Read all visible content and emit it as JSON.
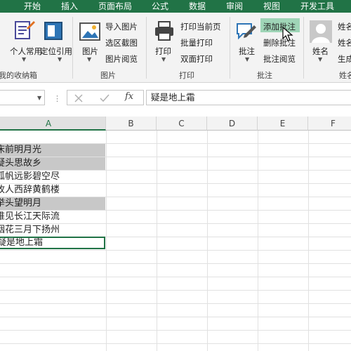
{
  "tabs": [
    "开始",
    "插入",
    "页面布局",
    "公式",
    "数据",
    "审阅",
    "视图",
    "开发工具"
  ],
  "ribbon": {
    "group_collection": {
      "label": "我的收纳箱",
      "buttons": [
        "个人常用",
        "定位引用"
      ]
    },
    "group_picture": {
      "label": "图片",
      "big_button": "图片",
      "small_buttons": [
        "导入图片",
        "选区截图",
        "图片阅览"
      ]
    },
    "group_print": {
      "label": "打印",
      "big_button": "打印",
      "small_buttons": [
        "打印当前页",
        "批量打印",
        "双面打印"
      ]
    },
    "group_comment": {
      "label": "批注",
      "big_button": "批注",
      "small_buttons": [
        "添加批注",
        "删除批注",
        "批注阅览"
      ]
    },
    "group_name": {
      "label": "姓名",
      "big_button": "姓名",
      "small_buttons": [
        "姓名",
        "姓名",
        "生成"
      ]
    }
  },
  "formula_bar": {
    "fx_label": "fx",
    "content": "疑是地上霜"
  },
  "columns": [
    "A",
    "B",
    "C",
    "D",
    "E",
    "F"
  ],
  "cells": [
    {
      "text": "床前明月光",
      "highlight": true
    },
    {
      "text": "疑头思故乡",
      "highlight": true
    },
    {
      "text": "孤帆远影碧空尽",
      "highlight": false
    },
    {
      "text": "故人西辞黄鹤楼",
      "highlight": false
    },
    {
      "text": "举头望明月",
      "highlight": true
    },
    {
      "text": "唯见长江天际流",
      "highlight": false
    },
    {
      "text": "烟花三月下扬州",
      "highlight": false
    },
    {
      "text": "疑是地上霜",
      "highlight": false
    }
  ],
  "colors": {
    "accent": "#217346",
    "highlight_button": "#9fd5b7",
    "cell_highlight": "#c8c8c8"
  }
}
